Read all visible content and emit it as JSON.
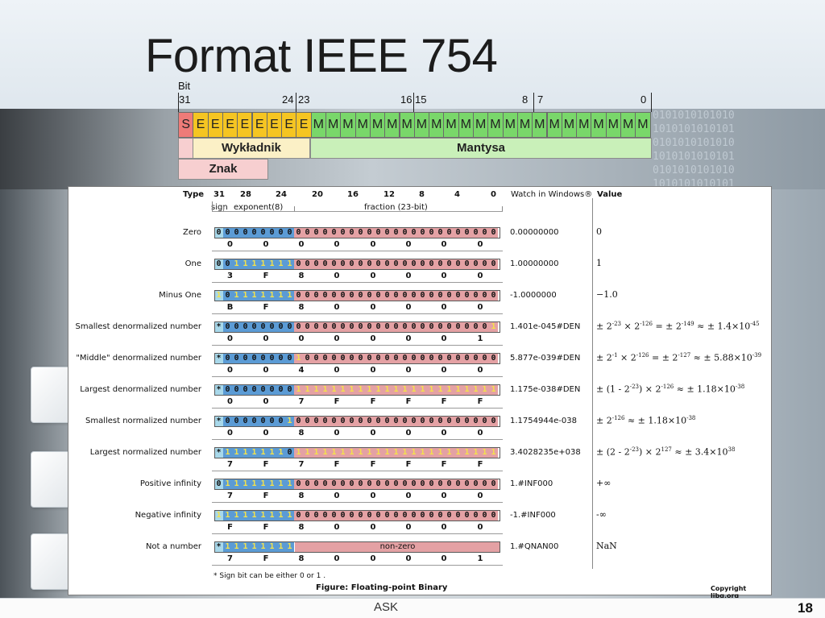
{
  "slide": {
    "title": "Format IEEE 754",
    "footer_left": "ASK",
    "page_number": "18"
  },
  "bit_layout": {
    "bit_label": "Bit",
    "positions": [
      "31",
      "24",
      "23",
      "16",
      "15",
      "8",
      "7",
      "0"
    ],
    "cells": [
      "S",
      "E",
      "E",
      "E",
      "E",
      "E",
      "E",
      "E",
      "E",
      "M",
      "M",
      "M",
      "M",
      "M",
      "M",
      "M",
      "M",
      "M",
      "M",
      "M",
      "M",
      "M",
      "M",
      "M",
      "M",
      "M",
      "M",
      "M",
      "M",
      "M",
      "M",
      "M"
    ],
    "exponent_label": "Wykładnik",
    "mantissa_label": "Mantysa",
    "sign_label": "Znak",
    "colors": {
      "sign": "#ee7b78",
      "exponent": "#f5c522",
      "mantissa": "#79d76a"
    }
  },
  "figure": {
    "header": {
      "type": "Type",
      "bit_ticks": [
        "31",
        "28",
        "24",
        "20",
        "16",
        "12",
        "8",
        "4",
        "0"
      ],
      "sign": "sign",
      "exponent": "exponent(8)",
      "fraction": "fraction (23-bit)",
      "watch": "Watch in Windows®",
      "value": "Value"
    },
    "rows": [
      {
        "label": "Zero",
        "sign": "0",
        "exp": "00000000",
        "frac": "00000000000000000000000",
        "hex": [
          "0",
          "0",
          "0",
          "0",
          "0",
          "0",
          "0",
          "0"
        ],
        "watch": "0.00000000",
        "value": "0"
      },
      {
        "label": "One",
        "sign": "0",
        "exp": "01111111",
        "frac": "00000000000000000000000",
        "hex": [
          "3",
          "F",
          "8",
          "0",
          "0",
          "0",
          "0",
          "0"
        ],
        "watch": "1.00000000",
        "value": "1"
      },
      {
        "label": "Minus One",
        "sign": "1",
        "exp": "01111111",
        "frac": "00000000000000000000000",
        "hex": [
          "B",
          "F",
          "8",
          "0",
          "0",
          "0",
          "0",
          "0"
        ],
        "watch": "-1.0000000",
        "value": "−1.0"
      },
      {
        "label": "Smallest denormalized number",
        "sign": "*",
        "exp": "00000000",
        "frac": "00000000000000000000001",
        "hex": [
          "0",
          "0",
          "0",
          "0",
          "0",
          "0",
          "0",
          "1"
        ],
        "watch": "1.401e-045#DEN",
        "value": "± 2^-23 × 2^-126 = ± 2^-149 ≈ ± 1.4×10^-45"
      },
      {
        "label": "\"Middle\" denormalized number",
        "sign": "*",
        "exp": "00000000",
        "frac": "10000000000000000000000",
        "hex": [
          "0",
          "0",
          "4",
          "0",
          "0",
          "0",
          "0",
          "0"
        ],
        "watch": "5.877e-039#DEN",
        "value": "± 2^-1 × 2^-126 = ± 2^-127 ≈ ± 5.88×10^-39"
      },
      {
        "label": "Largest denormalized number",
        "sign": "*",
        "exp": "00000000",
        "frac": "11111111111111111111111",
        "hex": [
          "0",
          "0",
          "7",
          "F",
          "F",
          "F",
          "F",
          "F"
        ],
        "watch": "1.175e-038#DEN",
        "value": "± (1 - 2^-23) × 2^-126 ≈ ± 1.18×10^-38"
      },
      {
        "label": "Smallest normalized number",
        "sign": "*",
        "exp": "00000001",
        "frac": "00000000000000000000000",
        "hex": [
          "0",
          "0",
          "8",
          "0",
          "0",
          "0",
          "0",
          "0"
        ],
        "watch": "1.1754944e-038",
        "value": "± 2^-126 ≈ ± 1.18×10^-38"
      },
      {
        "label": "Largest normalized number",
        "sign": "*",
        "exp": "11111110",
        "frac": "11111111111111111111111",
        "hex": [
          "7",
          "F",
          "7",
          "F",
          "F",
          "F",
          "F",
          "F"
        ],
        "watch": "3.4028235e+038",
        "value": "± (2 - 2^-23) × 2^127 ≈ ± 3.4×10^38"
      },
      {
        "label": "Positive infinity",
        "sign": "0",
        "exp": "11111111",
        "frac": "00000000000000000000000",
        "hex": [
          "7",
          "F",
          "8",
          "0",
          "0",
          "0",
          "0",
          "0"
        ],
        "watch": "1.#INF000",
        "value": "+∞"
      },
      {
        "label": "Negative infinity",
        "sign": "1",
        "exp": "11111111",
        "frac": "00000000000000000000000",
        "hex": [
          "F",
          "F",
          "8",
          "0",
          "0",
          "0",
          "0",
          "0"
        ],
        "watch": "-1.#INF000",
        "value": "-∞"
      },
      {
        "label": "Not a number",
        "sign": "*",
        "exp": "11111111",
        "frac": "non-zero",
        "hex": [
          "7",
          "F",
          "8",
          "0",
          "0",
          "0",
          "0",
          "1"
        ],
        "watch": "1.#QNAN00",
        "value": "NaN"
      }
    ],
    "footnote": "* Sign bit can be either 0 or 1 .",
    "caption": "Figure: Floating-point Binary",
    "copyright": "Copyright libg.org",
    "colors": {
      "sign": "#a8d8ea",
      "exponent": "#5b9bd5",
      "fraction": "#e4a1a4",
      "one_bit": "#f4e24a"
    }
  }
}
